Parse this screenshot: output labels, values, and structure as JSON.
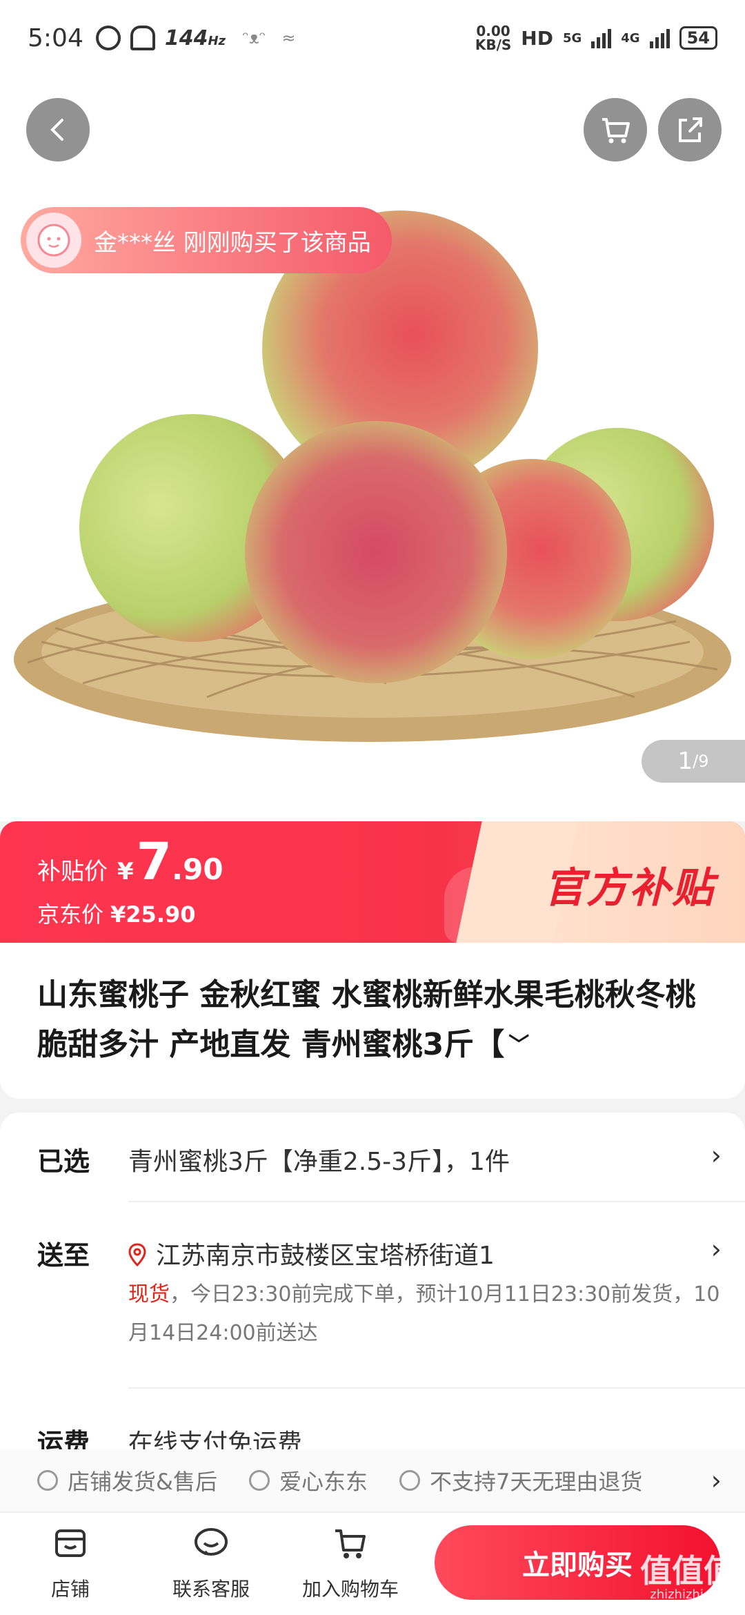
{
  "status_bar": {
    "time": "5:04",
    "refresh_rate": "144",
    "refresh_unit": "Hz",
    "speed_value": "0.00",
    "speed_unit": "KB/S",
    "hd": "HD",
    "net1": "5G",
    "net2": "4G",
    "battery": "54"
  },
  "hero": {
    "buyer_notice": "金***丝 刚刚购买了该商品",
    "pager_current": "1",
    "pager_total": "/9"
  },
  "price": {
    "subsidy_label": "补贴价",
    "currency": "¥",
    "subsidy_int": "7",
    "subsidy_dec": ".90",
    "jd_label": "京东价",
    "jd_price": "¥25.90",
    "official_label": "官方补贴"
  },
  "product": {
    "title": "山东蜜桃子 金秋红蜜 水蜜桃新鲜水果毛桃秋冬桃 脆甜多汁 产地直发 青州蜜桃3斤【"
  },
  "info": {
    "selected_label": "已选",
    "selected_value": "青州蜜桃3斤【净重2.5-3斤】，1件",
    "ship_to_label": "送至",
    "address": "江苏南京市鼓楼区宝塔桥街道1",
    "stock_status": "现货",
    "stock_detail": "，今日23:30前完成下单，预计10月11日23:30前发货，10月14日24:00前送达",
    "shipping_label": "运费",
    "shipping_value": "在线支付免运费"
  },
  "services": [
    "店铺发货&售后",
    "爱心东东",
    "不支持7天无理由退货"
  ],
  "bottom_bar": {
    "store": "店铺",
    "service": "联系客服",
    "add_cart": "加入购物车",
    "buy_now": "立即购买"
  },
  "watermark": {
    "main": "值值值",
    "sub": "zhizhizhi.com"
  },
  "colors": {
    "accent_red": "#f3112f",
    "price_red": "#ff3550",
    "stock_red": "#e2231a"
  }
}
